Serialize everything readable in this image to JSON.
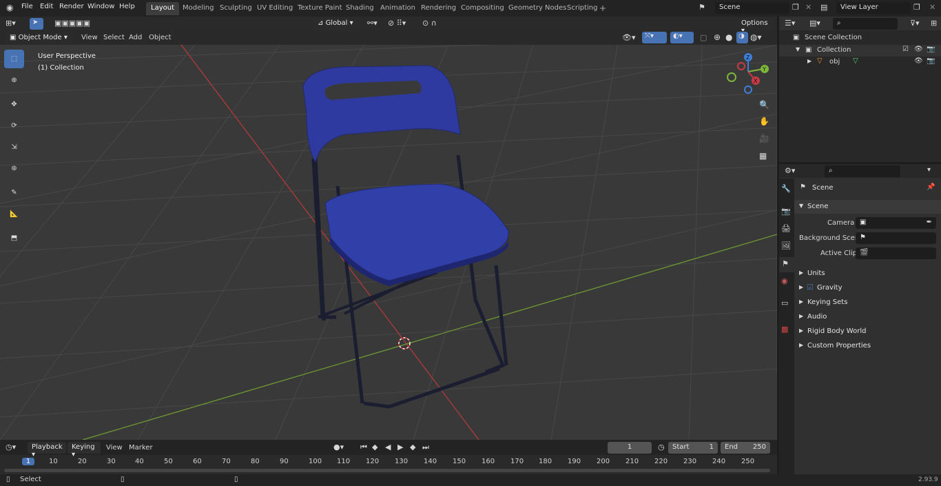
{
  "menu": {
    "file": "File",
    "edit": "Edit",
    "render": "Render",
    "window": "Window",
    "help": "Help"
  },
  "workspaces": [
    "Layout",
    "Modeling",
    "Sculpting",
    "UV Editing",
    "Texture Paint",
    "Shading",
    "Animation",
    "Rendering",
    "Compositing",
    "Geometry Nodes",
    "Scripting"
  ],
  "scene_field": "Scene",
  "viewlayer_field": "View Layer",
  "viewport": {
    "mode": "Object Mode",
    "view": "View",
    "select": "Select",
    "add": "Add",
    "object": "Object",
    "orientation": "Global",
    "options": "Options",
    "overlay_title": "User Perspective",
    "overlay_collection": "(1) Collection"
  },
  "gizmo": {
    "x": "X",
    "y": "Y",
    "z": "Z"
  },
  "outliner": {
    "scene_collection": "Scene Collection",
    "collection": "Collection",
    "obj": "obj"
  },
  "properties": {
    "header": "Scene",
    "panel": "Scene",
    "camera_label": "Camera",
    "background_scene_label": "Background Scene",
    "active_clip_label": "Active Clip",
    "sections": [
      "Units",
      "Gravity",
      "Keying Sets",
      "Audio",
      "Rigid Body World",
      "Custom Properties"
    ]
  },
  "timeline": {
    "playback": "Playback",
    "keying": "Keying",
    "view": "View",
    "marker": "Marker",
    "current_frame": "1",
    "start_label": "Start",
    "start_value": "1",
    "end_label": "End",
    "end_value": "250",
    "ruler": [
      "1",
      "10",
      "20",
      "30",
      "40",
      "50",
      "60",
      "70",
      "80",
      "90",
      "100",
      "110",
      "120",
      "130",
      "140",
      "150",
      "160",
      "170",
      "180",
      "190",
      "200",
      "210",
      "220",
      "230",
      "240",
      "250"
    ]
  },
  "status": {
    "select": "Select",
    "version": "2.93.9"
  },
  "colors": {
    "accent": "#4772b3",
    "chair_blue": "#2f3aa0",
    "x_axis": "#c83b44",
    "y_axis": "#7eb63a",
    "z_axis": "#3d7fd9"
  }
}
